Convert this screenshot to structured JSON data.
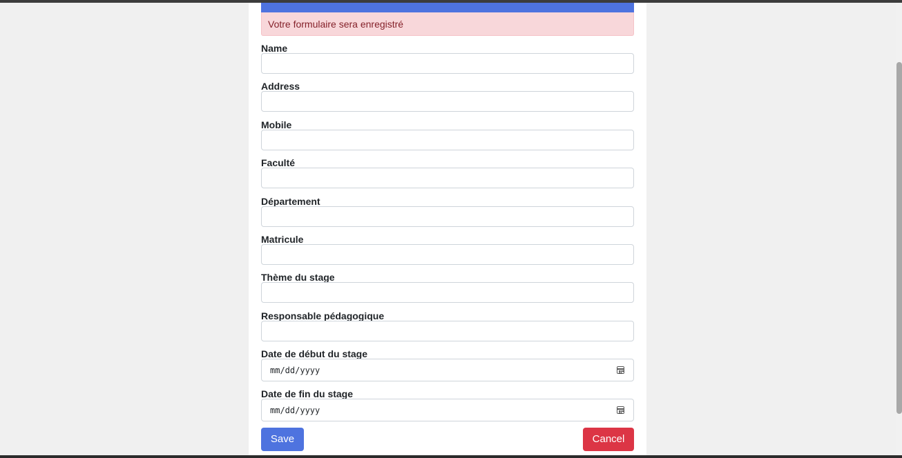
{
  "banner": {
    "title": ""
  },
  "alert": {
    "message": "Votre formulaire sera enregistré"
  },
  "form": {
    "fields": [
      {
        "label": "Name",
        "value": ""
      },
      {
        "label": "Address",
        "value": ""
      },
      {
        "label": "Mobile",
        "value": ""
      },
      {
        "label": "Faculté",
        "value": ""
      },
      {
        "label": "Département",
        "value": ""
      },
      {
        "label": "Matricule",
        "value": ""
      },
      {
        "label": "Thème du stage",
        "value": ""
      },
      {
        "label": "Responsable pédagogique",
        "value": ""
      }
    ],
    "start_date": {
      "label": "Date de début du stage",
      "placeholder": "mm/dd/yyyy"
    },
    "end_date": {
      "label": "Date de fin du stage",
      "placeholder": "mm/dd/yyyy"
    }
  },
  "buttons": {
    "save": "Save",
    "cancel": "Cancel"
  },
  "icons": {
    "calendar": "calendar-icon"
  },
  "colors": {
    "primary": "#4e73df",
    "danger": "#dc3545",
    "alert_bg": "#f8d7da",
    "alert_text": "#842029"
  }
}
